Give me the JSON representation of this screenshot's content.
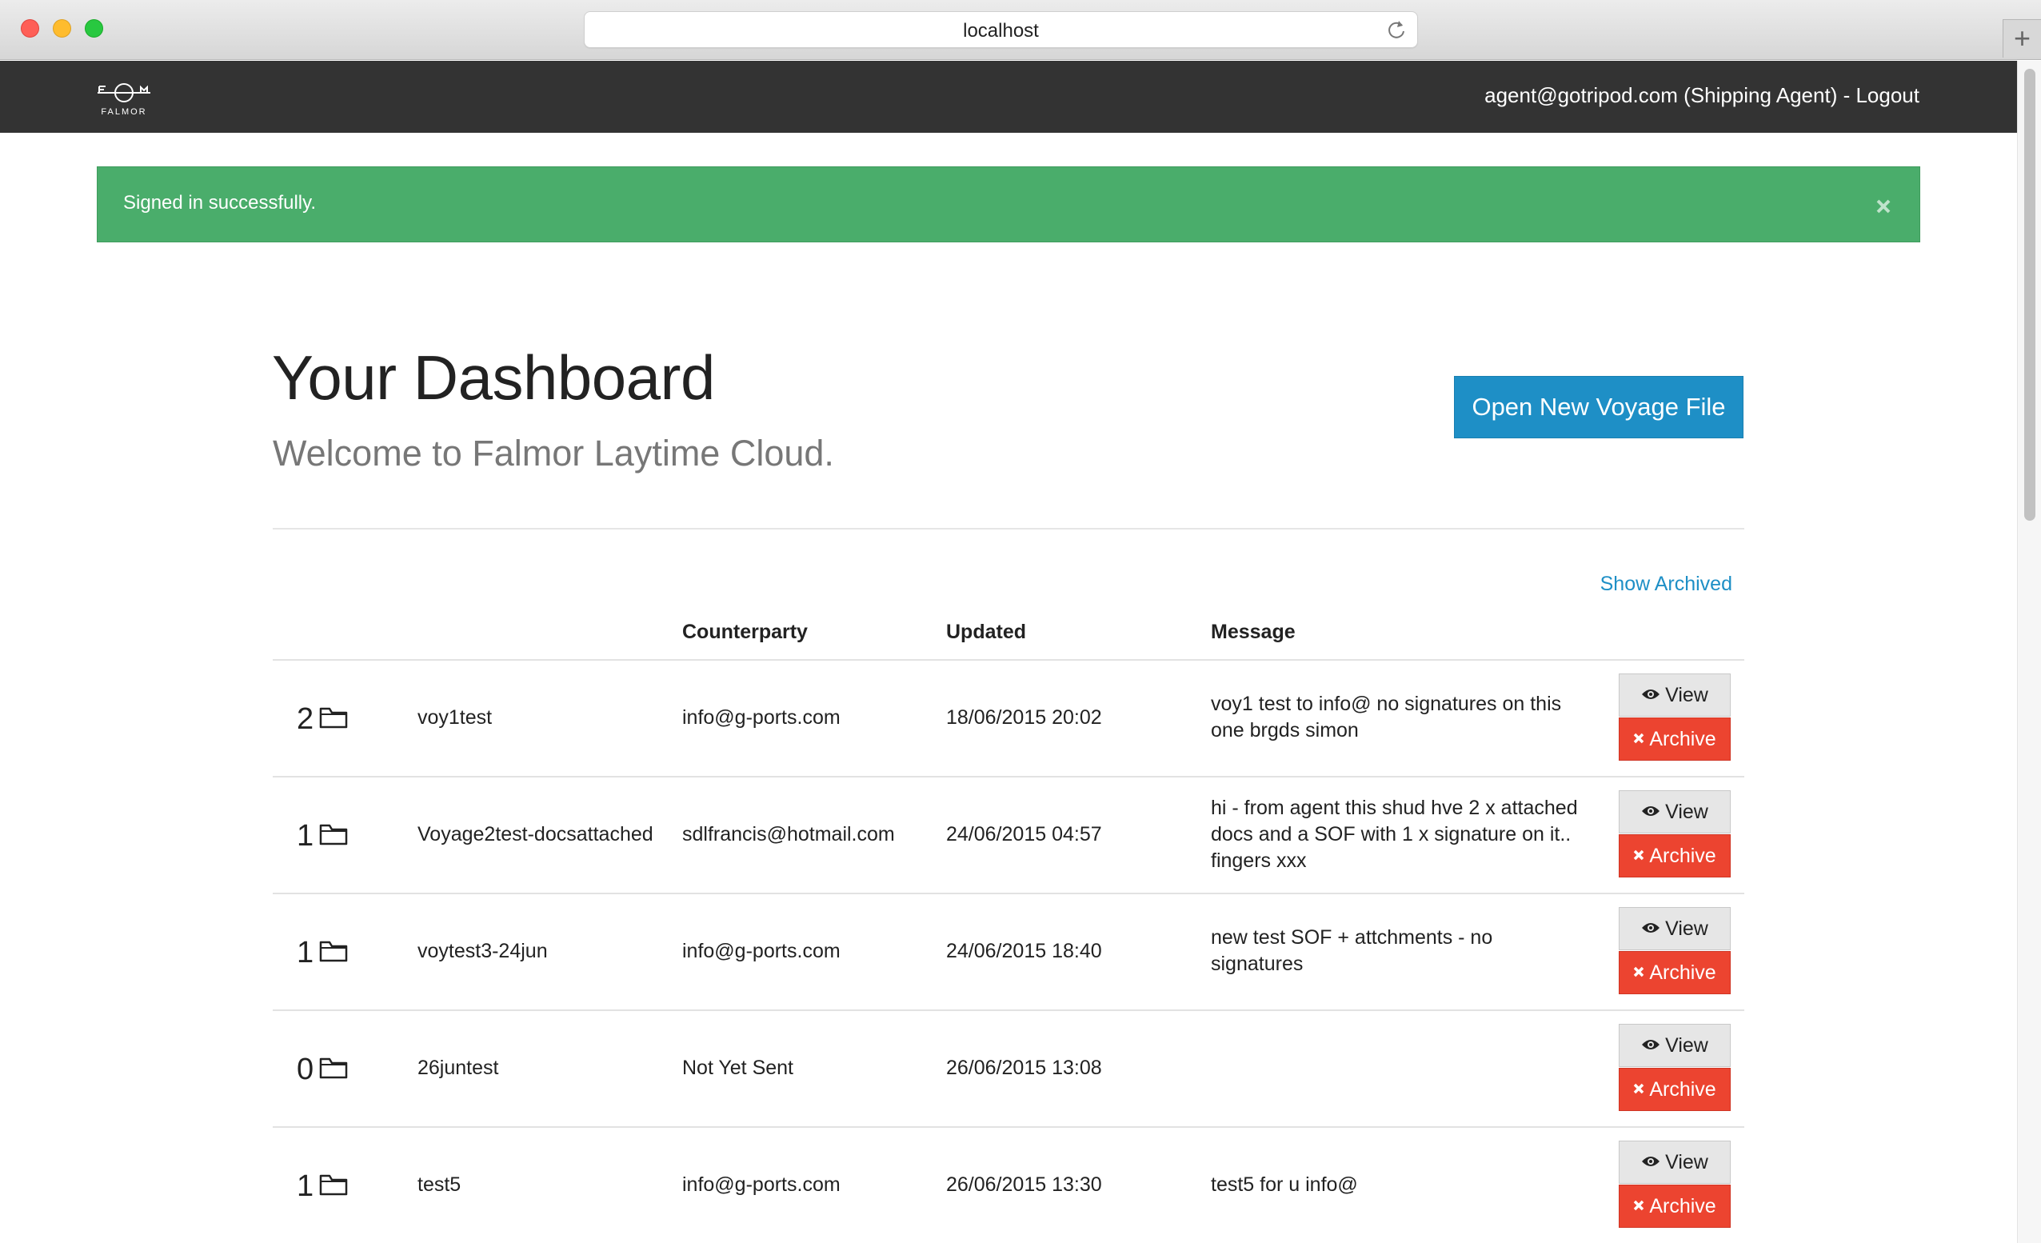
{
  "browser": {
    "url": "localhost"
  },
  "navbar": {
    "logo_text": "FALMOR",
    "user": "agent@gotripod.com (Shipping Agent) -",
    "logout_label": "Logout"
  },
  "alert": {
    "message": "Signed in successfully.",
    "close_glyph": "×"
  },
  "page": {
    "title": "Your Dashboard",
    "subtitle": "Welcome to Falmor Laytime Cloud.",
    "new_voyage_button": "Open New Voyage File",
    "show_archived": "Show Archived"
  },
  "table": {
    "headers": {
      "counterparty": "Counterparty",
      "updated": "Updated",
      "message": "Message"
    },
    "view_label": "View",
    "archive_label": "Archive",
    "rows": [
      {
        "count": "2",
        "name": "voy1test",
        "counterparty": "info@g-ports.com",
        "updated": "18/06/2015 20:02",
        "message_lines": [
          "voy1 test to info@ no signatures on this",
          "one brgds simon"
        ]
      },
      {
        "count": "1",
        "name": "Voyage2test-docsattached",
        "counterparty": "sdlfrancis@hotmail.com",
        "updated": "24/06/2015 04:57",
        "message_lines": [
          "hi - from agent this shud hve 2 x attached",
          "docs and a SOF with 1 x signature on it..",
          "fingers xxx"
        ]
      },
      {
        "count": "1",
        "name": "voytest3-24jun",
        "counterparty": "info@g-ports.com",
        "updated": "24/06/2015 18:40",
        "message_lines": [
          "new test SOF + attchments - no",
          "signatures"
        ]
      },
      {
        "count": "0",
        "name": "26juntest",
        "counterparty": "Not Yet Sent",
        "updated": "26/06/2015 13:08",
        "message_lines": []
      },
      {
        "count": "1",
        "name": "test5",
        "counterparty": "info@g-ports.com",
        "updated": "26/06/2015 13:30",
        "message_lines": [
          "test5 for u info@"
        ]
      }
    ]
  },
  "colors": {
    "navbar": "#333333",
    "alert": "#4aad6b",
    "primary": "#1e8fc6",
    "archive": "#ec4430"
  },
  "icons": [
    "reload-icon",
    "new-tab-icon",
    "falmor-logo",
    "close-icon",
    "folder-icon",
    "eye-icon",
    "x-icon"
  ]
}
